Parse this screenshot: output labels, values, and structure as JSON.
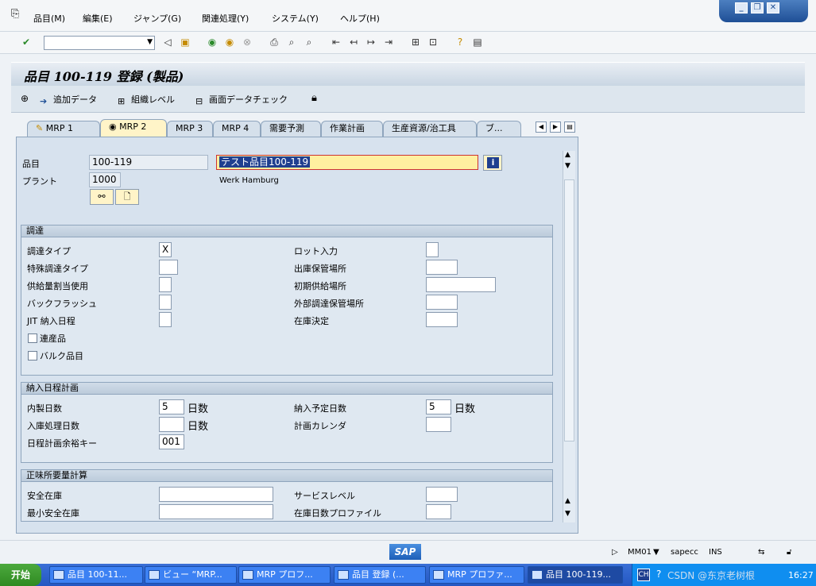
{
  "menu": {
    "items": [
      "品目(M)",
      "編集(E)",
      "ジャンプ(G)",
      "関連処理(Y)",
      "システム(Y)",
      "ヘルプ(H)"
    ]
  },
  "title": "品目 100-119 登録 (製品)",
  "app_toolbar": {
    "additional_data": "追加データ",
    "org_levels": "組織レベル",
    "check_screen_data": "画面データチェック"
  },
  "tabs": [
    {
      "label": "MRP 1"
    },
    {
      "label": "MRP 2",
      "active": true
    },
    {
      "label": "MRP 3"
    },
    {
      "label": "MRP 4"
    },
    {
      "label": "需要予測"
    },
    {
      "label": "作業計画"
    },
    {
      "label": "生産資源/治工具"
    },
    {
      "label": "ブ..."
    }
  ],
  "header": {
    "material_label": "品目",
    "material_value": "100-119",
    "material_desc": "テスト品目100-119",
    "plant_label": "プラント",
    "plant_value": "1000",
    "plant_name": "Werk Hamburg"
  },
  "procurement": {
    "title": "調達",
    "proc_type_label": "調達タイプ",
    "proc_type_value": "X",
    "special_proc_label": "特殊調達タイプ",
    "quota_label": "供給量割当使用",
    "backflush_label": "バックフラッシュ",
    "jit_label": "JIT 納入日程",
    "coproduct_label": "連産品",
    "bulk_label": "バルク品目",
    "batch_entry_label": "ロット入力",
    "issue_sloc_label": "出庫保管場所",
    "default_supply_label": "初期供給場所",
    "ext_sloc_label": "外部調達保管場所",
    "stock_det_label": "在庫決定"
  },
  "scheduling": {
    "title": "納入日程計画",
    "inhouse_label": "内製日数",
    "inhouse_value": "5",
    "gr_proc_label": "入庫処理日数",
    "sm_key_label": "日程計画余裕キー",
    "sm_key_value": "001",
    "planned_delivery_label": "納入予定日数",
    "planned_delivery_value": "5",
    "calendar_label": "計画カレンダ",
    "days_unit": "日数"
  },
  "net_req": {
    "title": "正味所要量計算",
    "safety_stock_label": "安全在庫",
    "min_safety_label": "最小安全在庫",
    "service_level_label": "サービスレベル",
    "coverage_profile_label": "在庫日数プロファイル"
  },
  "status": {
    "logo": "SAP",
    "transaction": "MM01",
    "server": "sapecc",
    "mode": "INS"
  },
  "taskbar": {
    "start": "开始",
    "tasks": [
      "品目 100-11...",
      "ビュー “MRP...",
      "MRP プロフ...",
      "品目 登録 (...",
      "MRP プロファ...",
      "品目 100-119..."
    ],
    "lang": "CH",
    "clock": "16:27",
    "watermark": "CSDN @东京老树根"
  },
  "colors": {
    "active_tab": "#fff4c8",
    "highlight": "#fff0a0",
    "title_bg": "#c9d6e3"
  }
}
